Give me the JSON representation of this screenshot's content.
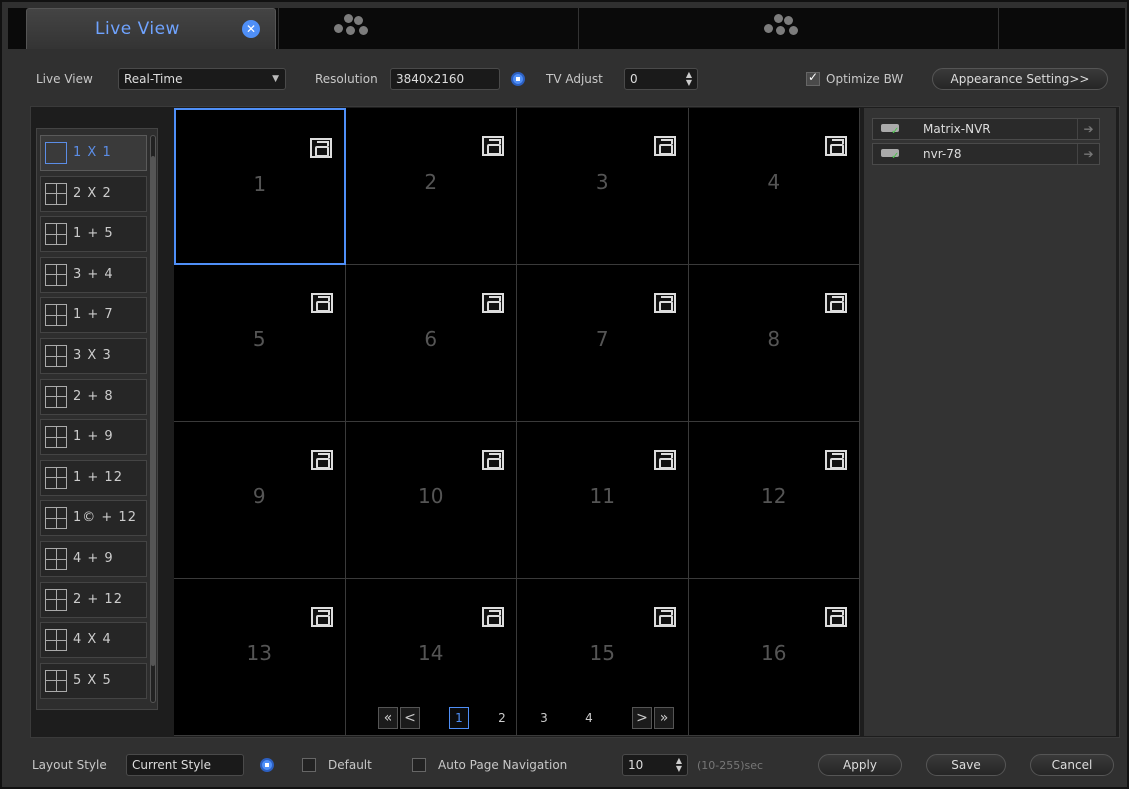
{
  "tabs": {
    "active_title": "Live View"
  },
  "toolbar": {
    "live_view_label": "Live View",
    "live_view_value": "Real-Time",
    "resolution_label": "Resolution",
    "resolution_value": "3840x2160",
    "tv_adjust_label": "TV Adjust",
    "tv_adjust_value": "0",
    "optimize_bw_label": "Optimize BW",
    "optimize_bw_checked": true,
    "appearance_button": "Appearance Setting>>"
  },
  "layouts": [
    {
      "label": "1 X 1",
      "selected": true
    },
    {
      "label": "2 X 2"
    },
    {
      "label": "1 + 5"
    },
    {
      "label": "3 + 4"
    },
    {
      "label": "1 + 7"
    },
    {
      "label": "3 X 3"
    },
    {
      "label": "2 + 8"
    },
    {
      "label": "1 + 9"
    },
    {
      "label": "1 + 12"
    },
    {
      "label": "1© + 12"
    },
    {
      "label": "4 + 9"
    },
    {
      "label": "2 + 12"
    },
    {
      "label": "4 X 4"
    },
    {
      "label": "5 X 5"
    }
  ],
  "grid": {
    "cells": [
      "1",
      "2",
      "3",
      "4",
      "5",
      "6",
      "7",
      "8",
      "9",
      "10",
      "11",
      "12",
      "13",
      "14",
      "15",
      "16"
    ],
    "selected_cell": "1",
    "cell_icon": "camera-group-icon"
  },
  "pager": {
    "first": "«",
    "prev": "<",
    "pages": [
      "1",
      "2",
      "3",
      "4"
    ],
    "current": "1",
    "next": ">",
    "last": "»"
  },
  "devices": [
    {
      "name": "Matrix-NVR",
      "icon": "nvr-online-icon"
    },
    {
      "name": "nvr-78",
      "icon": "nvr-online-icon"
    }
  ],
  "bottom": {
    "layout_style_label": "Layout Style",
    "layout_style_value": "Current Style",
    "default_label": "Default",
    "auto_page_label": "Auto Page Navigation",
    "auto_page_value": "10",
    "auto_page_hint": "(10-255)sec",
    "apply": "Apply",
    "save": "Save",
    "cancel": "Cancel"
  },
  "colors": {
    "accent": "#4f8ff7",
    "background": "#303030"
  }
}
